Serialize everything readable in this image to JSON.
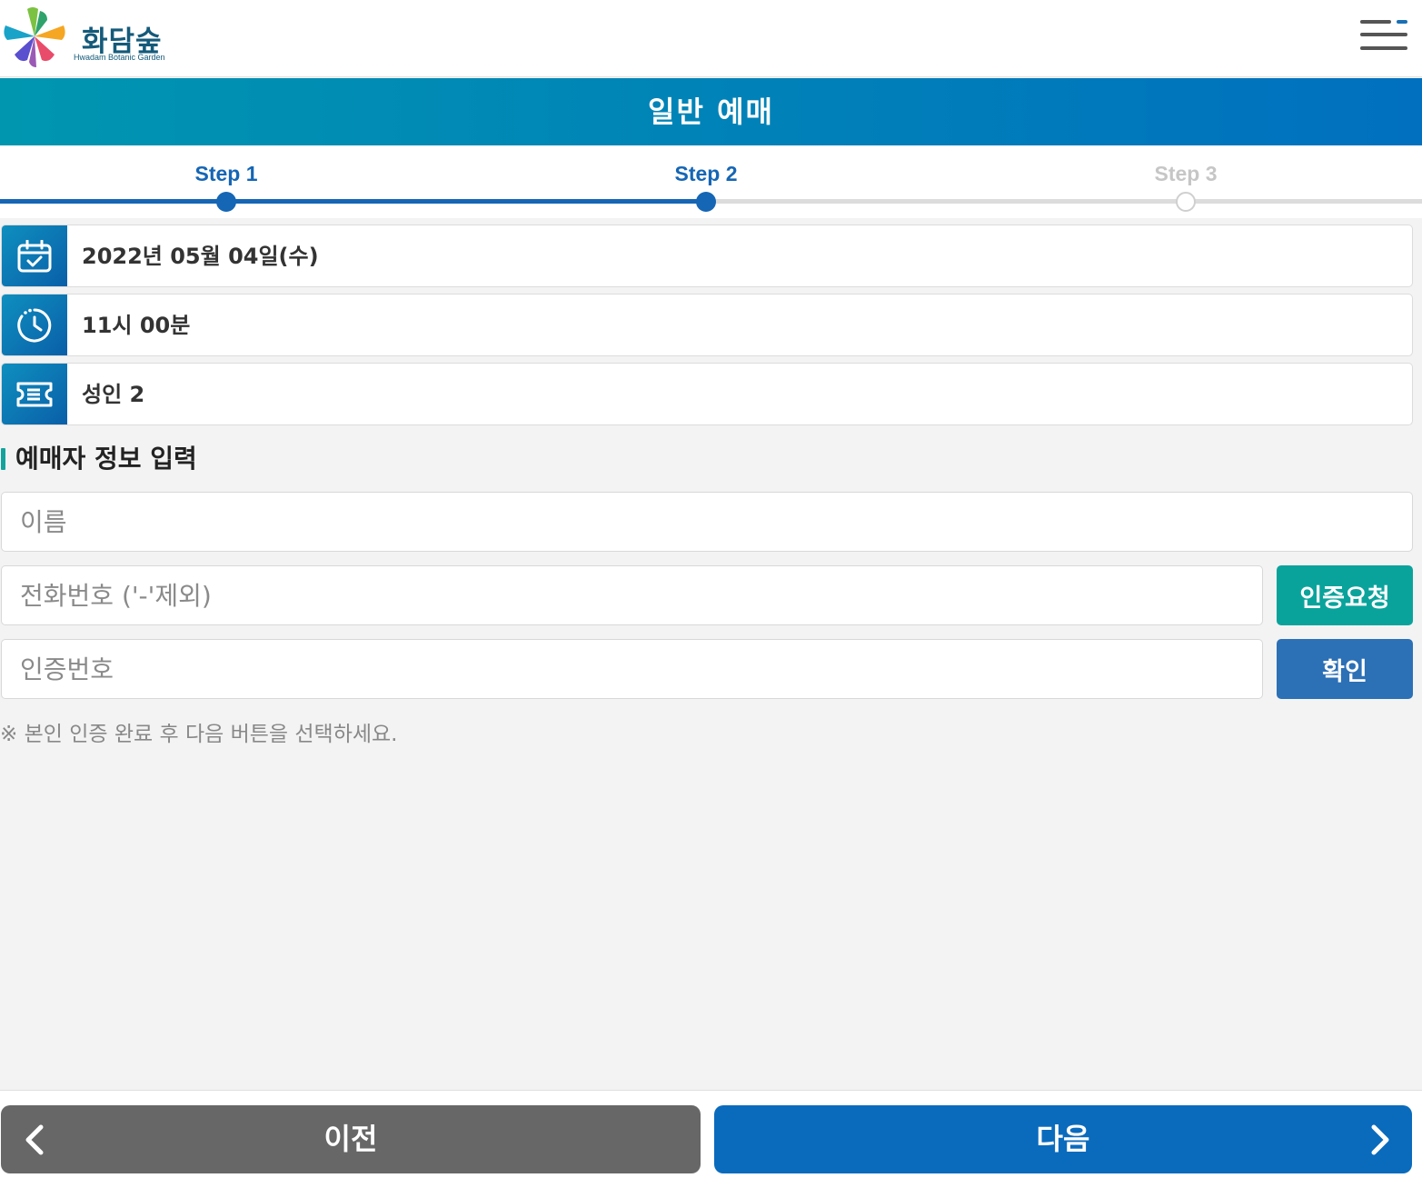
{
  "header": {
    "logo_title": "화담숲",
    "logo_subtitle": "Hwadam Botanic Garden",
    "menu_icon": "hamburger-menu-icon"
  },
  "page": {
    "title": "일반 예매"
  },
  "steps": {
    "items": [
      {
        "label": "Step 1",
        "state": "done"
      },
      {
        "label": "Step 2",
        "state": "current"
      },
      {
        "label": "Step 3",
        "state": "pending"
      }
    ],
    "active_color": "#1566b5"
  },
  "booking": {
    "date": {
      "icon": "calendar-check-icon",
      "text": "2022년 05월 04일(수)"
    },
    "time": {
      "icon": "clock-icon",
      "text": "11시 00분"
    },
    "tickets": {
      "icon": "ticket-icon",
      "text": "성인 2"
    }
  },
  "form": {
    "section_title": "예매자 정보 입력",
    "name_placeholder": "이름",
    "phone_placeholder": "전화번호 ('-'제외)",
    "code_placeholder": "인증번호",
    "request_button": "인증요청",
    "confirm_button": "확인",
    "notice": "※ 본인 인증 완료 후 다음 버튼을 선택하세요."
  },
  "footer": {
    "prev_label": "이전",
    "next_label": "다음",
    "prev_icon": "chevron-left-icon",
    "next_icon": "chevron-right-icon"
  },
  "colors": {
    "title_gradient_start": "#0096b0",
    "title_gradient_end": "#0070bf",
    "request_button": "#0aa39c",
    "confirm_button": "#2c70b6",
    "prev_button": "#676767",
    "next_button": "#0a6bbd"
  }
}
